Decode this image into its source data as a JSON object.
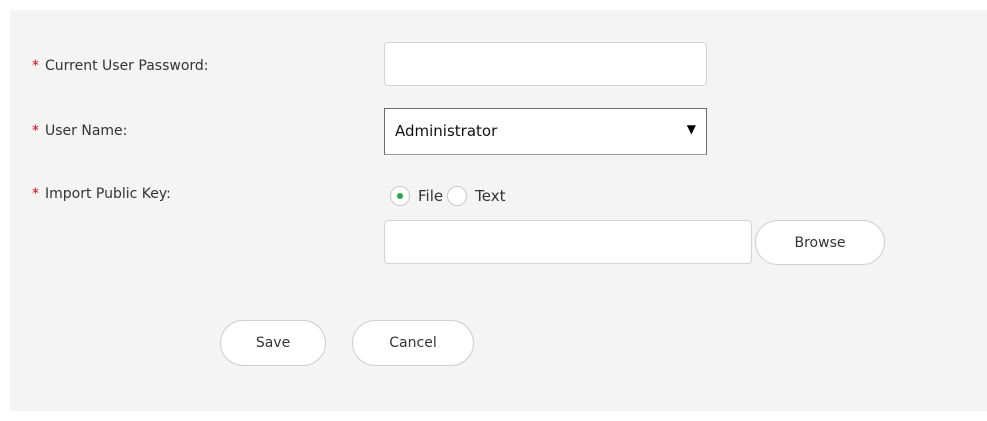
{
  "form": {
    "required_marker": "*",
    "current_password": {
      "label": "Current User Password:",
      "value": ""
    },
    "user_name": {
      "label": "User Name:",
      "selected": "Administrator",
      "arrow": "▼"
    },
    "public_key": {
      "label": "Import Public Key:",
      "options": [
        {
          "label": "File",
          "checked": true
        },
        {
          "label": "Text",
          "checked": false
        }
      ],
      "file_value": "",
      "browse_label": "Browse"
    },
    "actions": {
      "save_label": "Save",
      "cancel_label": "Cancel"
    }
  },
  "colors": {
    "panel_bg": "#f4f4f4",
    "required": "#e60012",
    "radio_checked": "#2aa845"
  }
}
